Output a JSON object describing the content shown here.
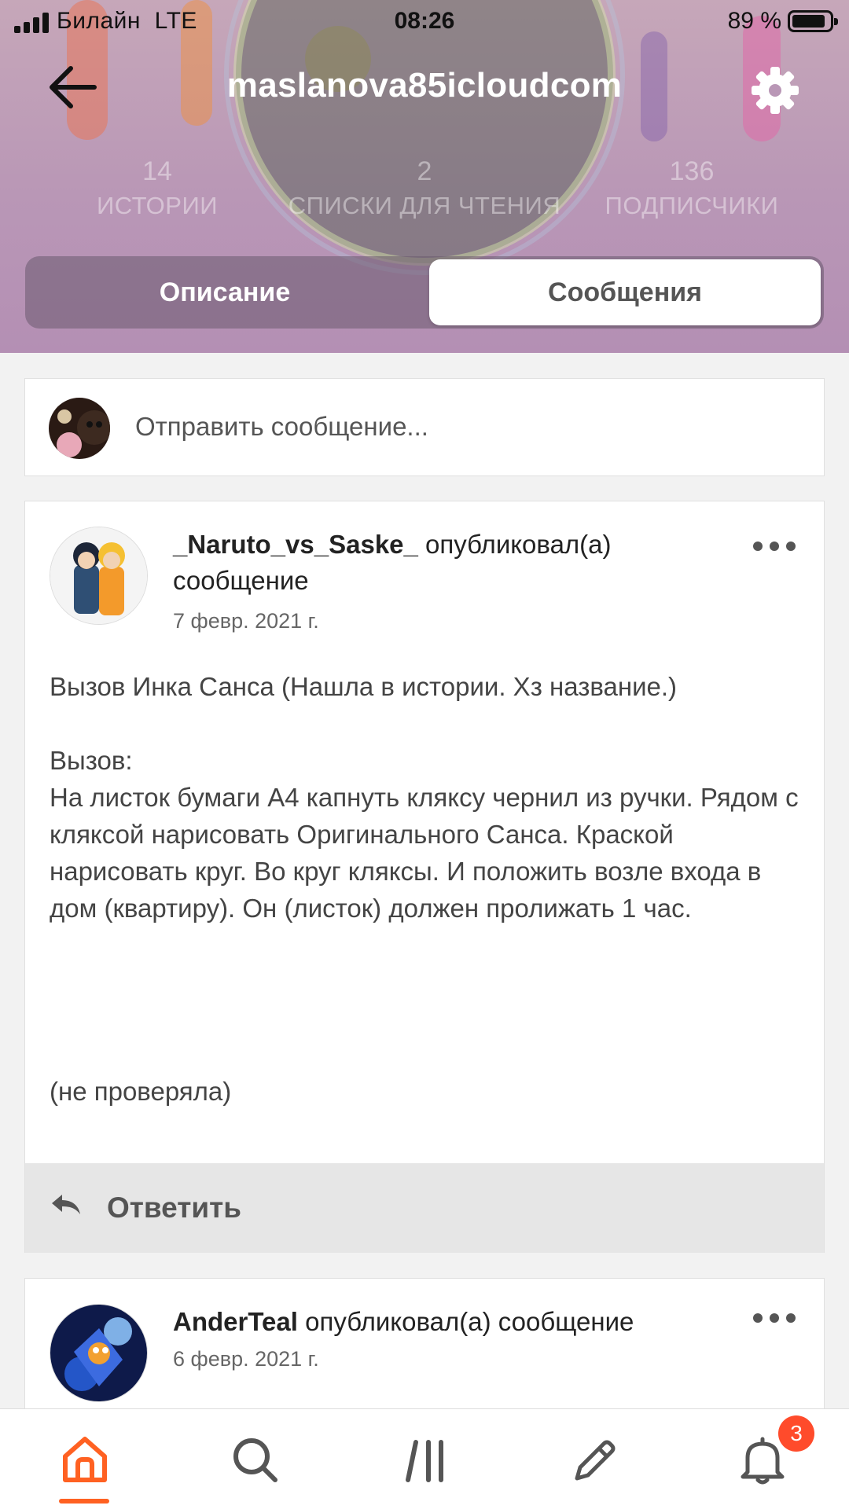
{
  "status_bar": {
    "carrier": "Билайн",
    "network": "LTE",
    "time": "08:26",
    "battery_percent": "89 %",
    "battery_level": 0.89
  },
  "profile": {
    "username": "maslanova85icloudcom",
    "stats": [
      {
        "value": "14",
        "label": "ИСТОРИИ"
      },
      {
        "value": "2",
        "label": "СПИСКИ ДЛЯ ЧТЕНИЯ"
      },
      {
        "value": "136",
        "label": "ПОДПИСЧИКИ"
      }
    ]
  },
  "tabs": {
    "about": "Описание",
    "messages": "Сообщения",
    "active": "messages"
  },
  "compose": {
    "placeholder": "Отправить сообщение..."
  },
  "posts": [
    {
      "author": "_Naruto_vs_Saske_",
      "action": "опубликовал(а) сообщение",
      "date": "7 февр. 2021 г.",
      "body": "Вызов Инка Санса (Нашла в истории. Хз название.)\n\nВызов:\nНа листок бумаги А4 капнуть кляксу чернил из ручки. Рядом с кляксой нарисовать Оригинального Санса. Краской нарисовать круг. Во круг кляксы. И положить возле входа в дом (квартиру). Он (листок) должен пролижать 1 час.",
      "note": "(не проверяла)",
      "reply_label": "Ответить"
    },
    {
      "author": "AnderTeal",
      "action": "опубликовал(а) сообщение",
      "date": "6 февр. 2021 г."
    }
  ],
  "bottom_nav": {
    "items": [
      "home",
      "search",
      "library",
      "write",
      "notifications"
    ],
    "active": "home",
    "notifications_badge": "3"
  },
  "colors": {
    "accent": "#ff6122",
    "badge": "#ff4b2b",
    "header_tint": "#b997b6"
  }
}
